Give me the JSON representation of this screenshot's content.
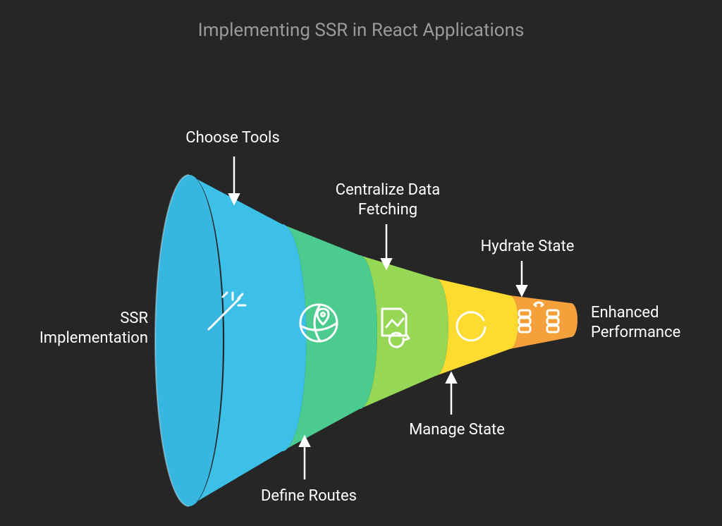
{
  "title": "Implementing SSR in React Applications",
  "left_label": "SSR\nImplementation",
  "right_label": "Enhanced\nPerformance",
  "segments": [
    {
      "label": "Choose Tools",
      "color": "#3DC0E8",
      "icon": "wand-icon",
      "label_side": "top"
    },
    {
      "label": "Define Routes",
      "color": "#4CCB8F",
      "icon": "globe-pin-icon",
      "label_side": "bottom"
    },
    {
      "label": "Centralize Data\nFetching",
      "color": "#96D756",
      "icon": "doc-chart-icon",
      "label_side": "top"
    },
    {
      "label": "Manage State",
      "color": "#FEDB2F",
      "icon": "cycle-icon",
      "label_side": "bottom"
    },
    {
      "label": "Hydrate State",
      "color": "#F5A03B",
      "icon": "servers-icon",
      "label_side": "top"
    }
  ],
  "colors": {
    "background": "#262626",
    "title": "#9a9a9a",
    "text": "#ffffff",
    "arrow": "#ffffff",
    "icon_stroke": "#ffffff"
  }
}
